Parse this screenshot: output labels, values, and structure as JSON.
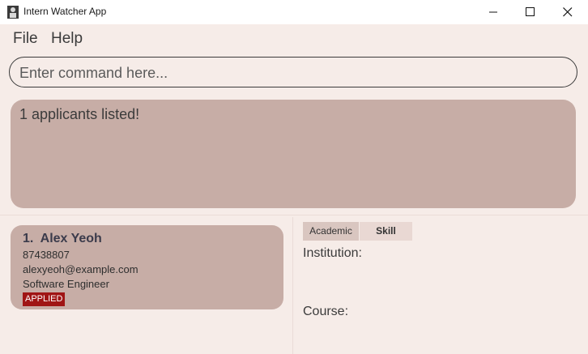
{
  "window": {
    "title": "Intern Watcher App",
    "controls": [
      "minimize",
      "maximize",
      "close"
    ]
  },
  "menu": {
    "file": "File",
    "help": "Help"
  },
  "command": {
    "placeholder": "Enter command here...",
    "value": ""
  },
  "result": {
    "message": "1 applicants listed!"
  },
  "applicants": [
    {
      "index": "1.",
      "name": "Alex Yeoh",
      "phone": "87438807",
      "email": "alexyeoh@example.com",
      "role": "Software Engineer",
      "status": "APPLIED"
    }
  ],
  "details": {
    "tabs": [
      "Academic",
      "Skill"
    ],
    "institution_label": "Institution:",
    "course_label": "Course:"
  },
  "colors": {
    "background": "#f6ece8",
    "panel": "#c7ada6",
    "status_applied": "#a01515"
  }
}
